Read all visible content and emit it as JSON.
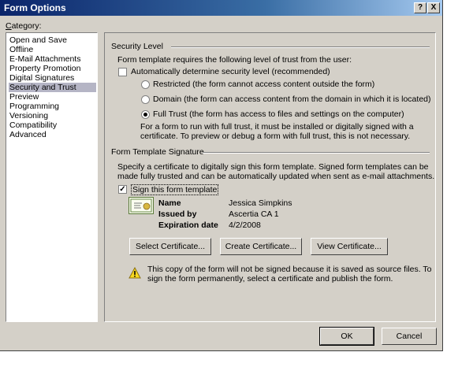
{
  "window": {
    "title": "Form Options",
    "help_btn": "?",
    "close_btn": "X"
  },
  "category": {
    "label": "Category:",
    "items": [
      {
        "label": "Open and Save"
      },
      {
        "label": "Offline"
      },
      {
        "label": "E-Mail Attachments"
      },
      {
        "label": "Property Promotion"
      },
      {
        "label": "Digital Signatures"
      },
      {
        "label": "Security and Trust"
      },
      {
        "label": "Preview"
      },
      {
        "label": "Programming"
      },
      {
        "label": "Versioning"
      },
      {
        "label": "Compatibility"
      },
      {
        "label": "Advanced"
      }
    ],
    "selected": "Security and Trust"
  },
  "security": {
    "heading": "Security Level",
    "intro": "Form template requires the following level of trust from the user:",
    "auto_label": "Automatically determine security level (recommended)",
    "restricted": "Restricted (the form cannot access content outside the form)",
    "domain": "Domain (the form can access content from the domain in which it is located)",
    "full": "Full Trust (the form has access to files and settings on the computer)",
    "note_line1": "For a form to run with full trust, it must be installed or digitally signed with a",
    "note_line2": "certificate. To preview or debug a form with full trust, this is not necessary."
  },
  "signature": {
    "heading": "Form Template Signature",
    "desc_line1": "Specify a certificate to digitally sign this form template. Signed form templates can be",
    "desc_line2": "made fully trusted and can be automatically updated when sent as e-mail attachments.",
    "sign_label": "Sign this form template",
    "name_label": "Name",
    "name_value": "Jessica Simpkins",
    "issued_label": "Issued by",
    "issued_value": "Ascertia CA 1",
    "exp_label": "Expiration date",
    "exp_value": "4/2/2008",
    "select_btn": "Select Certificate...",
    "create_btn": "Create Certificate...",
    "view_btn": "View Certificate...",
    "warn_line1": "This copy of the form will not be signed because it is saved as source files. To",
    "warn_line2": "sign the form permanently, select a certificate and publish the form."
  },
  "footer": {
    "ok": "OK",
    "cancel": "Cancel"
  },
  "colors": {
    "title_bar": "#0a246a",
    "dialog_bg": "#d4d0c8",
    "selection": "#b5b5c5"
  }
}
